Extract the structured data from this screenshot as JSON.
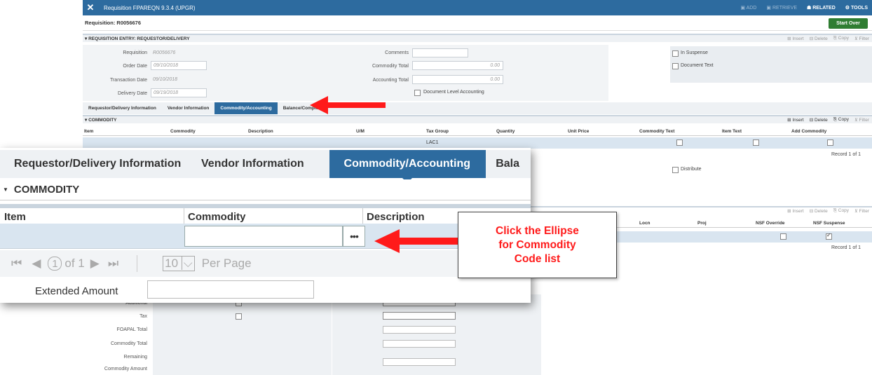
{
  "titlebar": {
    "title": "Requisition FPAREQN 9.3.4 (UPGR)",
    "add": "ADD",
    "retrieve": "RETRIEVE",
    "related": "RELATED",
    "tools": "TOOLS"
  },
  "requisition_bar": {
    "label": "Requisition: R0056676",
    "start_over": "Start Over"
  },
  "entry_section": {
    "title": "REQUISITION ENTRY: REQUESTOR/DELIVERY",
    "insert": "Insert",
    "delete": "Delete",
    "copy": "Copy",
    "filter": "Filter"
  },
  "form": {
    "requisition_label": "Requisition",
    "requisition_value": "R0056676",
    "order_date_label": "Order Date",
    "order_date_value": "09/10/2018",
    "transaction_date_label": "Transaction Date",
    "transaction_date_value": "09/10/2018",
    "delivery_date_label": "Delivery Date",
    "delivery_date_value": "09/19/2018",
    "comments_label": "Comments",
    "commodity_total_label": "Commodity Total",
    "commodity_total_value": "0.00",
    "accounting_total_label": "Accounting Total",
    "accounting_total_value": "0.00",
    "doc_level_accounting": "Document Level Accounting",
    "in_suspense": "In Suspense",
    "document_text": "Document Text"
  },
  "tabs": {
    "t1": "Requestor/Delivery Information",
    "t2": "Vendor Information",
    "t3": "Commodity/Accounting",
    "t4": "Balance/Completion"
  },
  "commodity_section": {
    "title": "COMMODITY",
    "insert": "Insert",
    "delete": "Delete",
    "copy": "Copy",
    "filter": "Filter"
  },
  "commodity_columns": {
    "item": "Item",
    "commodity": "Commodity",
    "description": "Description",
    "um": "U/M",
    "tax_group": "Tax Group",
    "quantity": "Quantity",
    "unit_price": "Unit Price",
    "commodity_text": "Commodity Text",
    "item_text": "Item Text",
    "add_commodity": "Add Commodity"
  },
  "commodity_row": {
    "tax_group": "LAC1"
  },
  "record1": "Record 1 of 1",
  "distribute": "Distribute",
  "accounting_columns": {
    "locn": "Locn",
    "proj": "Proj",
    "nsf_override": "NSF Override",
    "nsf_suspense": "NSF Suspense"
  },
  "record2": "Record 1 of 1",
  "balance": {
    "additional": "Additional",
    "tax": "Tax",
    "foapal_total": "FOAPAL Total",
    "commodity_total": "Commodity Total",
    "remaining1": "Remaining",
    "remaining2": "Commodity Amount"
  },
  "zoom": {
    "tab1": "Requestor/Delivery Information",
    "tab2": "Vendor Information",
    "tab3": "Commodity/Accounting",
    "tab4": "Bala",
    "section": "COMMODITY",
    "col_item": "Item",
    "col_commodity": "Commodity",
    "col_description": "Description",
    "ellipse": "•••",
    "page": "1",
    "of": "of 1",
    "per_page_value": "10",
    "per_page": "Per Page",
    "extended": "Extended Amount"
  },
  "callout": {
    "line1": "Click the Ellipse",
    "line2": "for Commodity",
    "line3": "Code list"
  },
  "colors": {
    "accent": "#2d6b9f",
    "arrow": "#ff1a1a",
    "start_over": "#2f7d32"
  }
}
